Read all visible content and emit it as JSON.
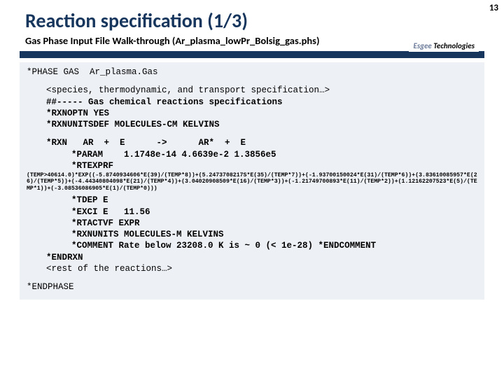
{
  "pageNumber": "13",
  "title": "Reaction specification (1/3)",
  "subtitle": "Gas Phase Input File Walk-through (Ar_plasma_lowPr_Bolsig_gas.phs)",
  "logo": {
    "prefix": "Esgee",
    "suffix": " Technologies"
  },
  "code": {
    "phase": "*PHASE GAS  Ar_plasma.Gas",
    "species": "<species, thermodynamic, and transport specification…>",
    "comment": "##----- Gas chemical reactions specifications",
    "rxnoptn": "*RXNOPTN YES",
    "rxnunitsdef": "*RXNUNITSDEF MOLECULES-CM KELVINS",
    "rxn": "*RXN   AR  +  E      ->      AR*  +  E",
    "param": "*PARAM    1.1748e-14 4.6639e-2 1.3856e5",
    "rtexprfLabel": "*RTEXPRF ",
    "rtexprfTiny": "(TEMP>40614.0)*EXP((-5.8740934606*E(39)/(TEMP*8))+(5.2473708217S*E(35)/(TEMP*7))+(-1.93700150024*E(31)/(TEMP*6))+(3.83610085957*E(26)/(TEMP*5))+(-4.44340804098*E(21)/(TEMP*4))+(3.04020908509*E(16)/(TEMP*3))+(-1.21749700893*E(11)/(TEMP*2))+(1.12162207523*E(5)/(TEMP*1))+(-3.08536086905*E(1)/(TEMP*0)))",
    "tdep": "*TDEP E",
    "exci": "*EXCI E   11.56",
    "rtactvf": "*RTACTVF EXPR",
    "rxnunits": "*RXNUNITS MOLECULES-M KELVINS",
    "commentRate": "*COMMENT Rate below 23208.0 K is ~ 0 (< 1e-28) *ENDCOMMENT",
    "endrxn": "*ENDRXN",
    "rest": "<rest of the reactions…>",
    "endphase": "*ENDPHASE"
  }
}
